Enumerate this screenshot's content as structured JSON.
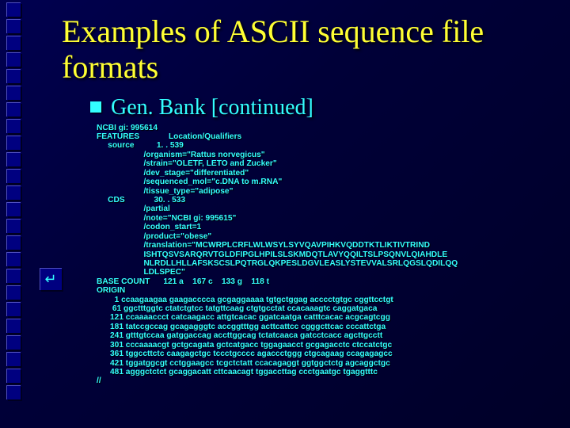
{
  "title": "Examples of ASCII sequence file formats",
  "subtitle": "Gen. Bank [continued]",
  "deco_squares": 24,
  "body": "NCBI gi: 995614\nFEATURES             Location/Qualifiers\n     source          1. . 539\n                     /organism=\"Rattus norvegicus\"\n                     /strain=\"OLETF, LETO and Zucker\"\n                     /dev_stage=\"differentiated\"\n                     /sequenced_mol=\"c.DNA to m.RNA\"\n                     /tissue_type=\"adipose\"\n     CDS             30. . 533\n                     /partial\n                     /note=\"NCBI gi: 995615\"\n                     /codon_start=1\n                     /product=\"obese\"\n                     /translation=\"MCWRPLCRFLWLWSYLSYVQAVPIHKVQDDTKTLIKTIVTRIND\n                     ISHTQSVSARQRVTGLDFIPGLHPILSLSKMDQTLAVYQQILTSLPSQNVLQIAHDLE\n                     NLRDLLHLLAFSKSCSLPQTRGLQKPESLDGVLEASLYSTEVVALSRLQGSLQDILQQ\n                     LDLSPEC\"\nBASE COUNT      121 a    167 c    133 g    118 t\nORIGIN\n        1 ccaagaagaa gaagacccca gcgaggaaaa tgtgctggag acccctgtgc cggttcctgt\n       61 ggctttggtc ctatctgtcc tatgttcaag ctgtgcctat ccacaaagtc caggatgaca\n      121 ccaaaaccct catcaagacc attgtcacac ggatcaatga catttcacac acgcagtcgg\n      181 tatccgccag gcagagggtc accggtttgg acttcattcc cgggcttcac cccattctga\n      241 gtttgtccaa gatggaccag accttggcag tctatcaaca gatcctcacc agcttgcctt\n      301 cccaaaacgt gctgcagata gctcatgacc tggagaacct gcgagacctc ctccatctgc\n      361 tggccttctc caagagctgc tccctgcccc agaccctggg ctgcagaag ccagagagcc\n      421 tggatggcgt cctggaagcc tcgctctatt ccacagaggt ggtggctctg agcaggctgc\n      481 agggctctct gcaggacatt cttcaacagt tggaccttag ccctgaatgc tgaggtttc\n//"
}
